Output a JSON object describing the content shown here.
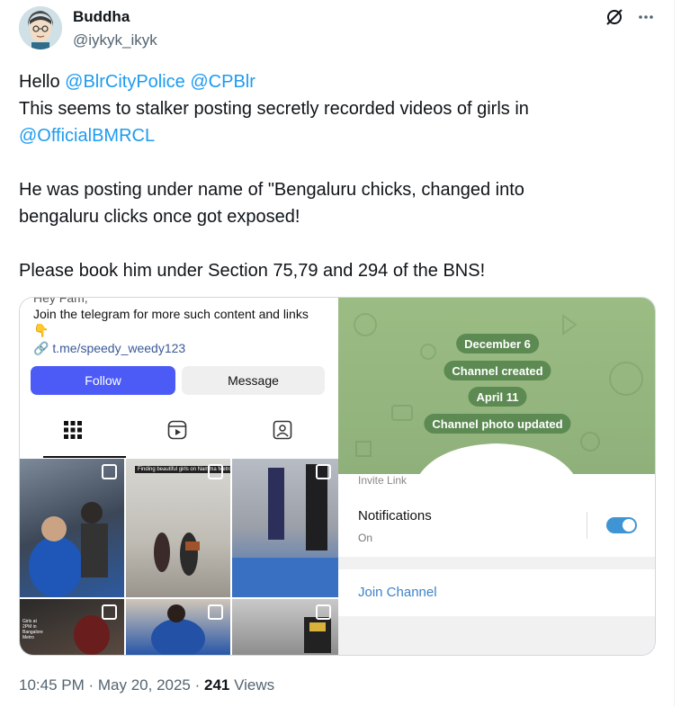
{
  "author": {
    "name": "Buddha",
    "handle": "@iykyk_ikyk"
  },
  "tweet": {
    "greeting": "Hello",
    "mention_1": "@BlrCityPolice",
    "mention_2": "@CPBlr",
    "line_2": "This seems to stalker posting secretly recorded videos of girls in",
    "mention_3": "@OfficialBMRCL",
    "line_4": "He was posting under name of \"Bengaluru chicks, changed into",
    "line_5": "bengaluru clicks once got exposed!",
    "line_6": "Please book him under Section 75,79 and 294 of the BNS!"
  },
  "instagram": {
    "bio_cut": "Hey Fam,",
    "bio_line": "Join the telegram for more such content and links",
    "emoji": "👇",
    "link": "t.me/speedy_weedy123",
    "follow_label": "Follow",
    "message_label": "Message",
    "thumb_captions": [
      "Finding beautiful girls on Namma Metro",
      "Girls at 2PM in Bangalore Metro"
    ]
  },
  "telegram": {
    "pills": [
      "December 6",
      "Channel created",
      "April 11",
      "Channel photo updated"
    ],
    "invite_label": "Invite Link",
    "notifications_label": "Notifications",
    "notifications_status": "On",
    "join_label": "Join Channel",
    "toggle_on": true
  },
  "footer": {
    "time": "10:45 PM",
    "date": "May 20, 2025",
    "views_count": "241",
    "views_label": "Views"
  },
  "colors": {
    "link": "#1d9bf0",
    "follow": "#4c5bf6",
    "telegram_green": "#8fb07a",
    "toggle": "#3f95d4"
  }
}
